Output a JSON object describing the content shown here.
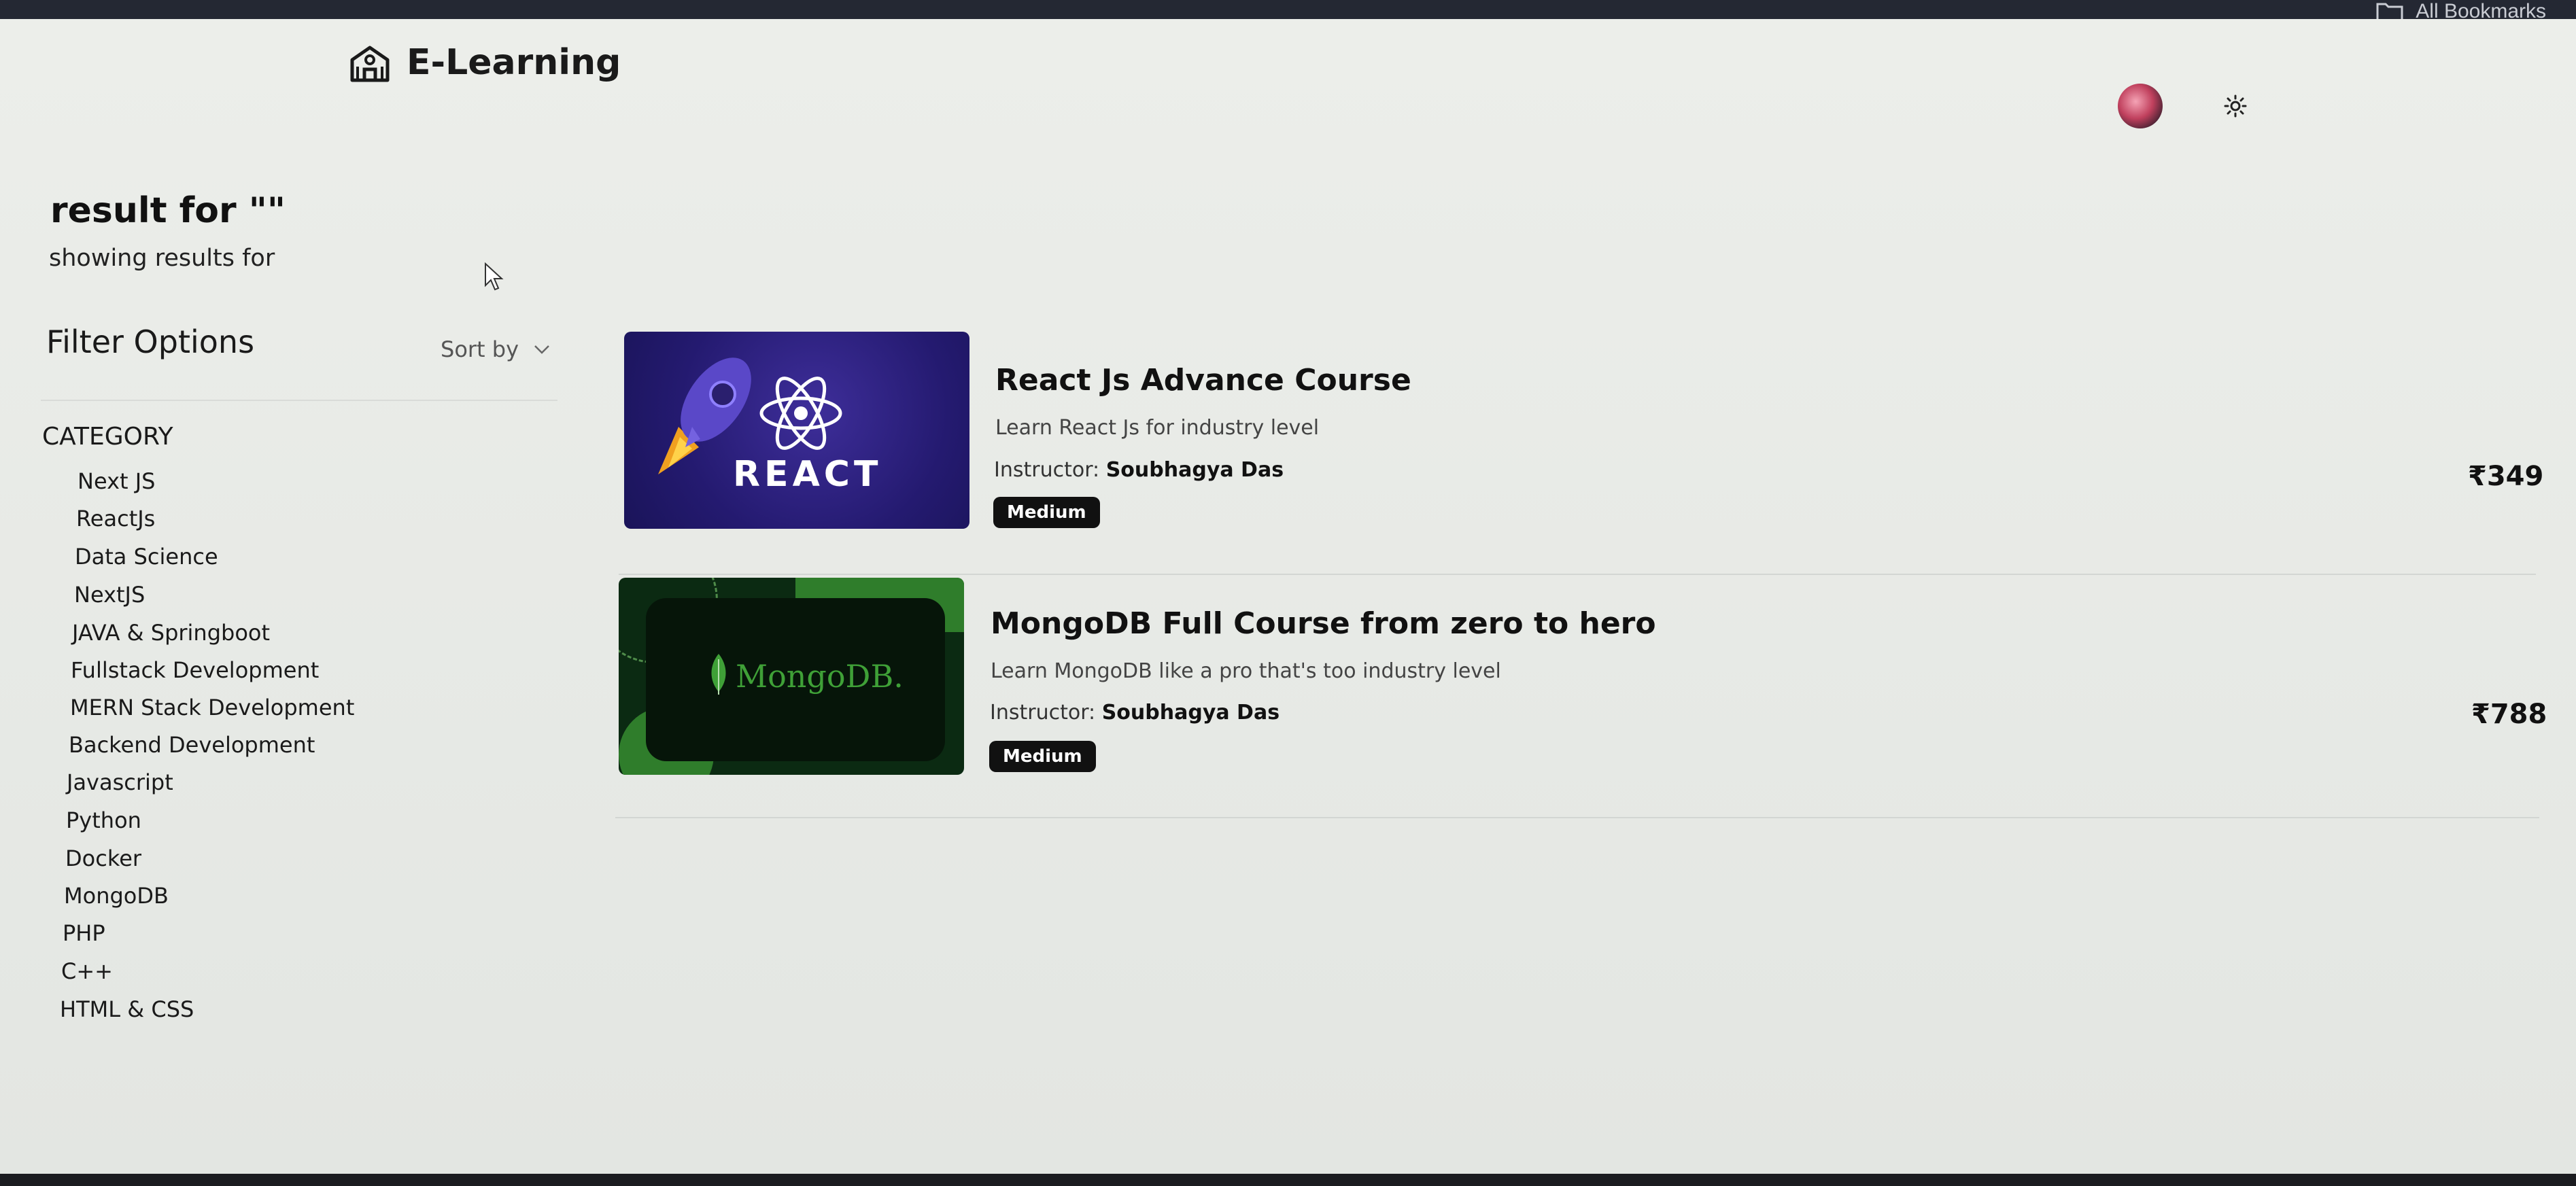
{
  "browser": {
    "bookmarks_label": "All Bookmarks"
  },
  "header": {
    "brand": "E-Learning"
  },
  "search": {
    "title": "result for \"\"",
    "subtitle": "showing results for"
  },
  "filters": {
    "title": "Filter Options",
    "sort_label": "Sort by",
    "category_heading": "CATEGORY",
    "categories": [
      "Next JS",
      "ReactJs",
      "Data Science",
      "NextJS",
      "JAVA & Springboot",
      "Fullstack Development",
      "MERN Stack Development",
      "Backend Development",
      "Javascript",
      "Python",
      "Docker",
      "MongoDB",
      "PHP",
      "C++",
      "HTML & CSS"
    ]
  },
  "courses": [
    {
      "title": "React Js Advance Course",
      "description": "Learn React Js for industry level",
      "instructor_label": "Instructor:",
      "instructor": "Soubhagya Das",
      "level": "Medium",
      "price": "₹349",
      "thumb_text": "REACT"
    },
    {
      "title": "MongoDB Full Course from zero to hero",
      "description": "Learn MongoDB like a pro that's too industry level",
      "instructor_label": "Instructor:",
      "instructor": "Soubhagya Das",
      "level": "Medium",
      "price": "₹788",
      "thumb_text": "MongoDB."
    }
  ],
  "colors": {
    "react_accent": "#61dafb",
    "mongo_green": "#3fa037",
    "badge_bg": "#111111"
  },
  "icons": [
    "folder-icon",
    "school-icon",
    "sun-icon",
    "chevron-down-icon",
    "cursor-icon",
    "react-atom-icon",
    "rocket-icon",
    "mongodb-leaf-icon"
  ]
}
